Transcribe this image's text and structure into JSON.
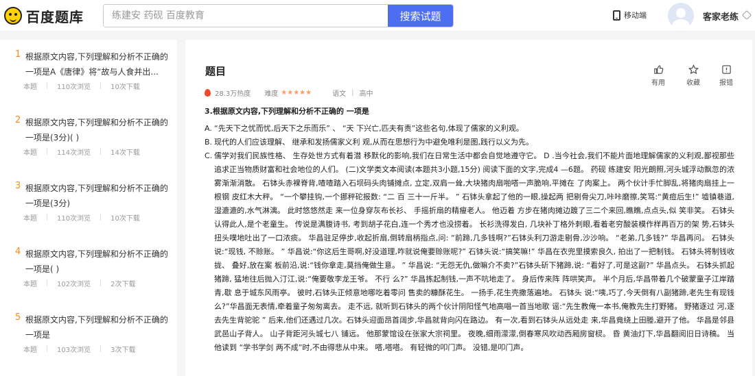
{
  "header": {
    "logo_text": "百度题库",
    "search_placeholder": "练建安 药砚 百度教育",
    "search_button": "搜索试题",
    "mobile_label": "移动端",
    "username": "客家老练"
  },
  "sidebar": {
    "items": [
      {
        "num": "1",
        "title": "根据原文内容,下列理解和分析不正确的一项是A《唐律》将“故与人食并出...",
        "tag": "本题",
        "views": "110次浏览",
        "downloads": "10次下载"
      },
      {
        "num": "2",
        "title": "根据原文内容,下列理解和分析不正确的一项是(3分)( )",
        "tag": "本题",
        "views": "114次浏览",
        "downloads": "14次下载"
      },
      {
        "num": "3",
        "title": "根据原文内容,下列理解和分析不正确的一项是(3分)",
        "tag": "本题",
        "views": "110次浏览",
        "downloads": "10次下载"
      },
      {
        "num": "4",
        "title": "根据原文内容,下列理解和分析不正确的一项是( )",
        "tag": "本题",
        "views": "102次浏览",
        "downloads": "2次下载"
      },
      {
        "num": "5",
        "title": "根据原文内容,下列理解和分析不正确的一项是",
        "tag": "本题",
        "views": "103次浏览",
        "downloads": "3次下载"
      }
    ]
  },
  "question": {
    "heading": "题目",
    "heat": "28.3万热度",
    "difficulty_label": "难度",
    "difficulty_stars": "★★★★★",
    "subject": "语文",
    "grade": "高中",
    "stem": "3.根据原文内容,下列理解和分析不正确的 一项是",
    "options": [
      {
        "key": "A.",
        "text": "“先天下之忧而忧,后天下之乐而乐” 、 “天 下兴亡,匹夫有责”这些名句,体现了儒家的义利观。"
      },
      {
        "key": "B.",
        "text": "现代的人们应该理解、 继承和发扬儒家义利 观,从而在思想行为中避免唯利是图,践行以义为先。"
      },
      {
        "key": "C.",
        "text": "儒学对我们民族性格、 生存处世方式有着潜 移默化的影响,我们在日常生活中都会自觉地遵守它。 D .当今社会,我们不能片面地理解儒家的义利观,鄙视那些追求正当物质财富和社会地位的人们。 (二)文学类文本阅读(本题共3小题,15分) 阅读下面的文字,完成4 —6题。 药砚 练建安 阳光朗照,河头城浮动飘忽的浓雾渐渐消散。 石钵头赤裸脊背,喳喳踏入石坝码头肉铺摊点, 立定,双肩一耸,大块猪肉扇啪嗒一声脆响,平摊在 了肉案上。 两个伙计手忙脚乱,将猪肉扇挂上一根钢 皮红木大秤。 “一个攀挂钩,一个挪秤砣报数: “二 百 三十一斤半。 ” 石钵头拿起了他的一眼,操起两 把剔骨尖刀,咔咔磨擦,笑骂:“黄痘后生!” 墟镇巷道,湿漉漉的,水气淋漓。 此时悠悠然走 来一位身穿灰布长衫、 手摇折扇的精瘦老人。 他迈着 方步在猪肉摊边踱了三二个来回,瞧瞧,点点头,似 笑非笑。 石钵头认得此人,是个老童生。 传说是满腹诗书, 考到胡子花白,连一个秀才也没捞着。 长衫洗得发白, 几块补丁格外刺眼,看着老穷酸装模作样再百万的架 势,石钵头扭头噗地吐出了一口浓痰。 华昌驻足停步,收起折扇,倒转扇柄指点,问: “前蹄,几多钱啊?”石钵头利刀游走剔骨,沙沙响。 “老弟,几多钱?” 华昌再问。 石钵头说:“现钱, 不赊账。 ” 华昌说:“你这后生哥啊,好没道理,咋就说俺要赊账呢?” 石钵头说:“搞笑嘛!” 华昌在衣兜里摸索良久, 拍出了一把制钱。 石钵头将制钱收拢、 叠好,放在案 板前沿,说:“钱你拿走,莫挡俺做生意。 ” 华昌说: “无怨无仇,做嘛介不卖?”石钵头斫下猪蹄,说: “看好了,可是这副?” 华昌点头。 石钵头抓起猪蹄, 猛地往后抛入汀江,说:“俺要敬李龙王爷。 不行 么?” 华昌拣起制钱,一声不吭地走了。 身后传来阵 阵哄笑声。 半个月后,华昌带着几个破蒙童子江岸踏青,歇 息于城东风雨亭。 彼时,石钵头正倾意地哪吃着零问 售卖的糠酥花生。 一扬手,花生壳撒落遍地。 石钵头 说:“咦,巧了,今天倒有八副猪蹄,老先生有现钱 么?”华昌面无表情,牵着童子匆匆离去。 走不远, 就听到石钵头的两个伙计阴阳怪气地高唱一首当地歌 谣:“先生教俺一本书,俺教先生打野猪。 野猪逐过 河,逐去先生背驼驼 ” 后来,他们还遇过几次。石钵头迎面昂首阔步,华昌就背向闪在路边。 有一次,看到石钵头从远处走 来,华昌竟绕上田塍,避开了他。 华昌是邻县武邑山子背人。 山子背距河头城七八 铺远。 他那蒙馆设在张家大宗祠里。 夜晚,细雨濛濛,倒春寒风吹动西厢房窗棂。 昏 黄油灯下,华昌翻阅旧日诗稿。 当他读到 “学书学剑 两不成”时,不由得悲从中来。 嗒,嗒嗒。 有轻微的叩门声。 没错,是叩门声。"
      }
    ]
  },
  "actions": [
    {
      "label": "有用"
    },
    {
      "label": "收藏"
    },
    {
      "label": "报错"
    }
  ]
}
